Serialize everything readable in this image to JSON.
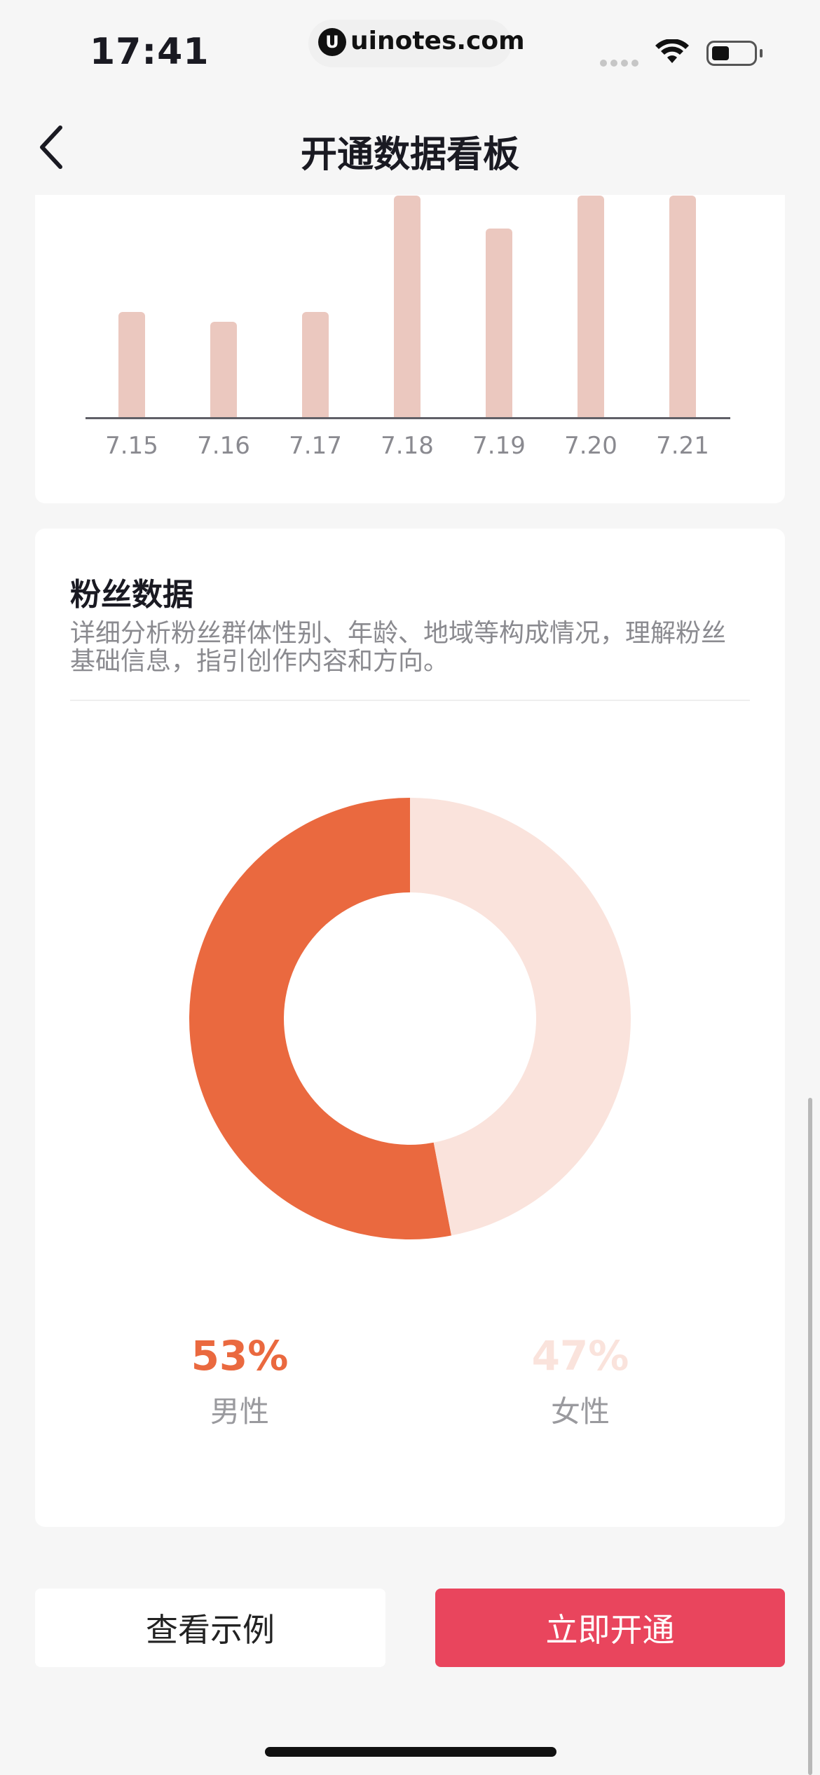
{
  "status_bar": {
    "time": "17:41",
    "url_logo_letter": "U",
    "url": "uinotes.com",
    "wifi_icon": "wifi-icon",
    "battery_icon": "battery-icon",
    "battery_level": 0.35
  },
  "nav": {
    "title": "开通数据看板",
    "back_icon": "chevron-left-icon"
  },
  "chart_data": {
    "type": "bar",
    "categories": [
      "7.15",
      "7.16",
      "7.17",
      "7.18",
      "7.19",
      "7.20",
      "7.21"
    ],
    "values": [
      42,
      38,
      42,
      88,
      75,
      88,
      88
    ],
    "ylim": [
      0,
      100
    ],
    "bar_color": "#ebc8bf",
    "grid": false,
    "note_clipped_top": true
  },
  "fans": {
    "title": "粉丝数据",
    "description": "详细分析粉丝群体性别、年龄、地域等构成情况，理解粉丝基础信息，指引创作内容和方向。",
    "male_pct": "53%",
    "male_label": "男性",
    "female_pct": "47%",
    "female_label": "女性",
    "male_value": 53,
    "female_value": 47,
    "male_color": "#ea693f",
    "female_color": "#fae3dc"
  },
  "buttons": {
    "example": "查看示例",
    "open": "立即开通",
    "open_color": "#e9455d"
  }
}
